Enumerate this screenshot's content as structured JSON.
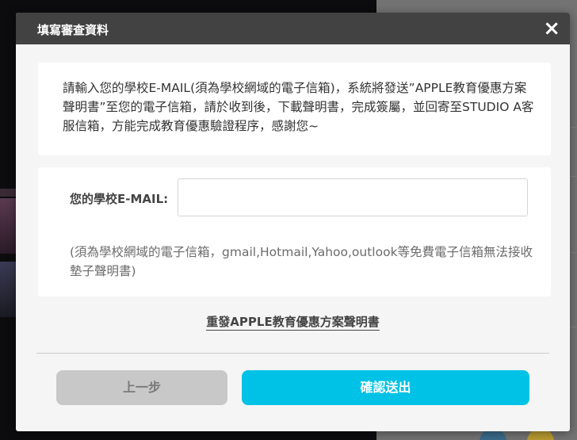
{
  "modal": {
    "title": "填寫審查資料",
    "close_icon": "×"
  },
  "notice": {
    "text": "請輸入您的學校E-MAIL(須為學校網域的電子信箱)，系統將發送”APPLE教育優惠方案聲明書”至您的電子信箱，請於收到後，下載聲明書，完成簽屬，並回寄至STUDIO A客服信箱，方能完成教育優惠驗證程序，感謝您~"
  },
  "form": {
    "email_label": "您的學校E-MAIL:",
    "email_value": "",
    "hint": "(須為學校網域的電子信箱，gmail,Hotmail,Yahoo,outlook等免費電子信箱無法接收墊子聲明書)"
  },
  "resend_link": "重發APPLE教育優惠方案聲明書",
  "buttons": {
    "prev": "上一步",
    "submit": "確認送出"
  },
  "colors": {
    "header_bg": "#424242",
    "submit_bg": "#00c2e6",
    "prev_bg": "#c8c8c8",
    "modal_bg": "#f5f5f5"
  }
}
